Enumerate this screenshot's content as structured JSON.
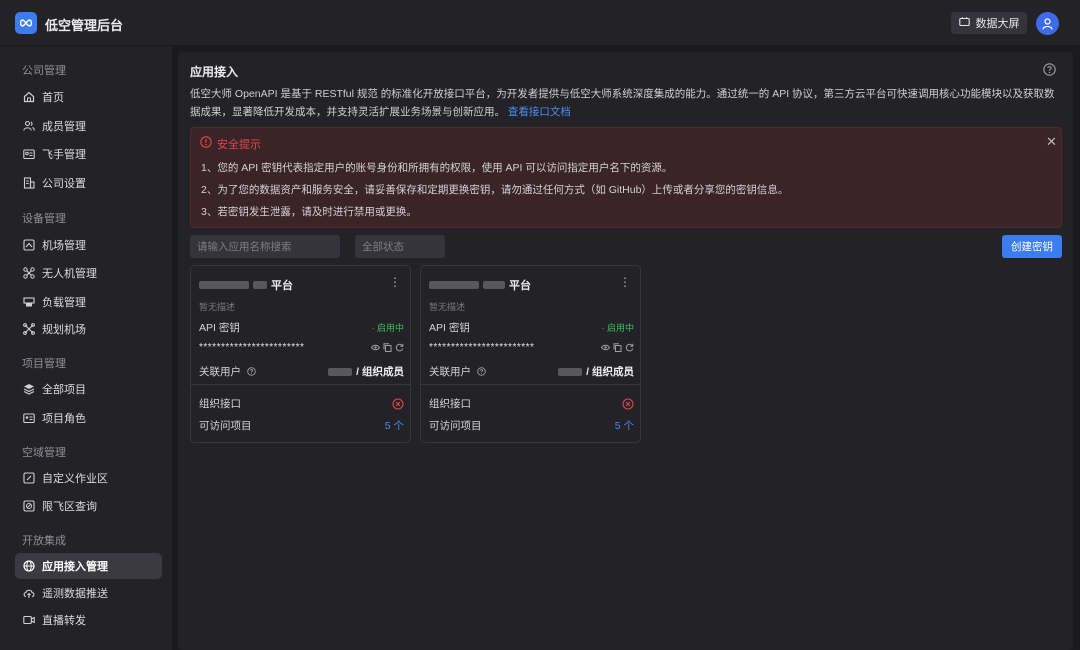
{
  "header": {
    "title": "低空管理后台",
    "big_screen_label": "数据大屏"
  },
  "sidebar": {
    "groups": [
      {
        "label": "公司管理",
        "items": [
          "首页",
          "成员管理",
          "飞手管理",
          "公司设置"
        ]
      },
      {
        "label": "设备管理",
        "items": [
          "机场管理",
          "无人机管理",
          "负载管理",
          "规划机场"
        ]
      },
      {
        "label": "项目管理",
        "items": [
          "全部项目",
          "项目角色"
        ]
      },
      {
        "label": "空域管理",
        "items": [
          "自定义作业区",
          "限飞区查询"
        ]
      },
      {
        "label": "开放集成",
        "items": [
          "应用接入管理",
          "遥测数据推送",
          "直播转发"
        ]
      }
    ],
    "active_item": "应用接入管理"
  },
  "main": {
    "title": "应用接入",
    "intro": "低空大师 OpenAPI 是基于 RESTful 规范 的标准化开放接口平台，为开发者提供与低空大师系统深度集成的能力。通过统一的 API 协议，第三方云平台可快速调用核心功能模块以及获取数据成果，显著降低开发成本，并支持灵活扩展业务场景与创新应用。",
    "doc_link": "查看接口文档",
    "alert": {
      "title": "安全提示",
      "lines": [
        "1、您的 API 密钥代表指定用户的账号身份和所拥有的权限，使用 API 可以访问指定用户名下的资源。",
        "2、为了您的数据资产和服务安全，请妥善保存和定期更换密钥，请勿通过任何方式（如 GitHub）上传或者分享您的密钥信息。",
        "3、若密钥发生泄露，请及时进行禁用或更换。"
      ]
    },
    "search_placeholder": "请输入应用名称搜索",
    "status_placeholder": "全部状态",
    "create_button": "创建密钥"
  },
  "cards": [
    {
      "name_suffix": "平台",
      "description": "暂无描述",
      "api_key_label": "API 密钥",
      "status": "· 启用中",
      "key_masked": "************************",
      "linked_user_label": "关联用户",
      "linked_user_role": "/ 组织成员",
      "org_api_label": "组织接口",
      "projects_label": "可访问项目",
      "projects_count": "5 个"
    },
    {
      "name_suffix": "平台",
      "description": "暂无描述",
      "api_key_label": "API 密钥",
      "status": "· 启用中",
      "key_masked": "************************",
      "linked_user_label": "关联用户",
      "linked_user_role": "/ 组织成员",
      "org_api_label": "组织接口",
      "projects_label": "可访问项目",
      "projects_count": "5 个"
    }
  ],
  "colors": {
    "accent": "#3d7bf0",
    "success": "#3dbb63",
    "danger": "#e0474c",
    "link": "#4a8cf5"
  }
}
